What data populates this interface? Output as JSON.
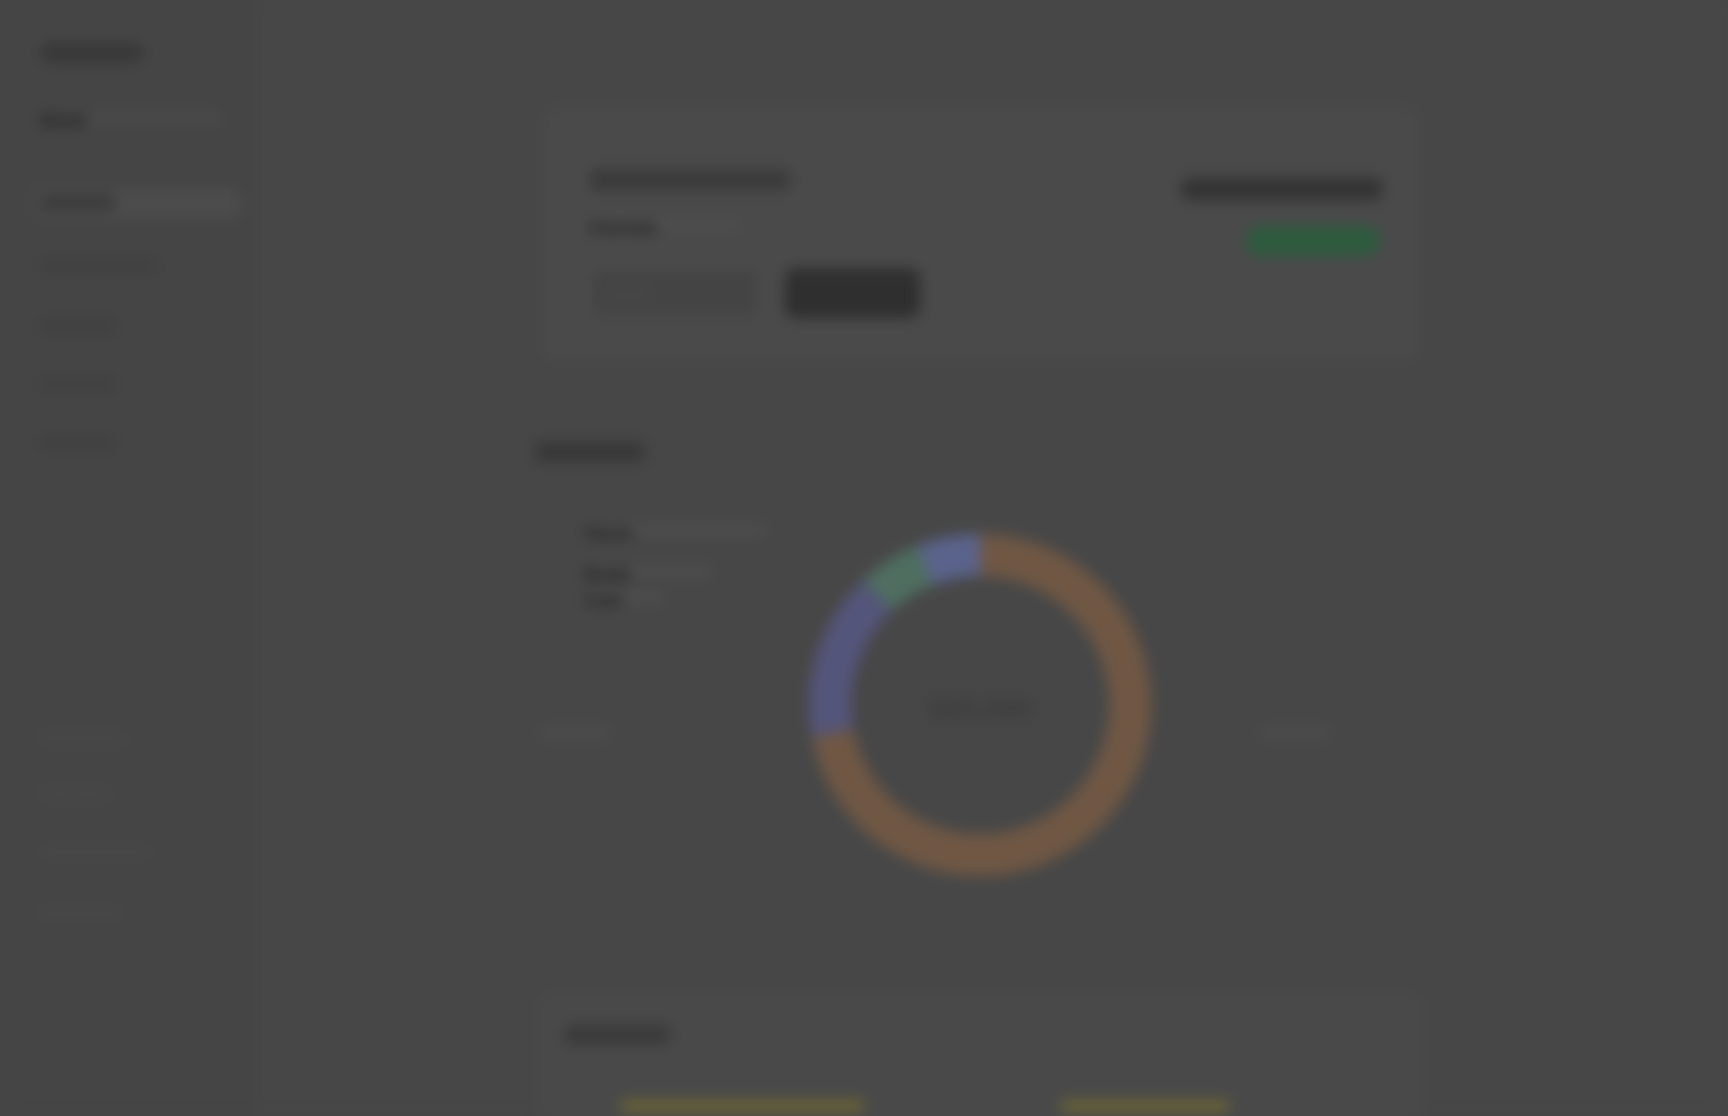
{
  "app": {
    "logo": "Portfolio",
    "logo_subtitle": "Brand"
  },
  "sidebar": {
    "items": [
      {
        "label": "Overview"
      },
      {
        "label": "Transactions"
      },
      {
        "label": "Accounts"
      },
      {
        "label": "Reports"
      },
      {
        "label": "Settings"
      }
    ],
    "bottom_items": [
      {
        "label": "Help Center"
      },
      {
        "label": "Contact"
      },
      {
        "label": "Documentation"
      },
      {
        "label": "Privacy"
      }
    ]
  },
  "account_card": {
    "title": "Personal Account",
    "subtitle": "Overview",
    "search_placeholder": "Search",
    "button_label": "Search",
    "balance": "$20,000.00",
    "status": "Active"
  },
  "allocation": {
    "title": "Allocation",
    "center_value": "$20,000",
    "legend": [
      {
        "label": "Stocks"
      },
      {
        "label": "Bonds"
      },
      {
        "label": "Cash"
      }
    ]
  },
  "recent": {
    "title": "Recent"
  },
  "chart_data": {
    "type": "pie",
    "categories": [
      "Stocks",
      "Bonds",
      "Cash",
      "Other"
    ],
    "values": [
      72,
      16,
      6,
      6
    ],
    "title": "Allocation",
    "center_label": "$20,000"
  },
  "colors": {
    "stocks": "#6f5744",
    "bonds": "#54557a",
    "cash": "#4f6e60",
    "other": "#5a638b",
    "status": "#2d5b3e",
    "button": "#2f2f2f"
  }
}
